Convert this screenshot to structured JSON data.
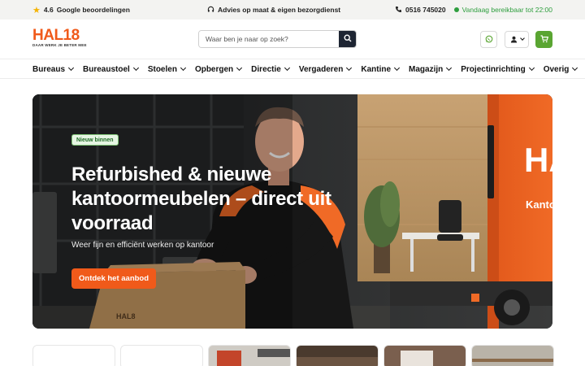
{
  "topbar": {
    "rating": "4.6",
    "rating_label": "Google beoordelingen",
    "advice": "Advies op maat & eigen bezorgdienst",
    "phone": "0516 745020",
    "availability": "Vandaag bereikbaar tot 22:00"
  },
  "header": {
    "logo_text": "HAL18",
    "logo_tagline": "DAAR WERK JE BETER MEE",
    "search_placeholder": "Waar ben je naar op zoek?"
  },
  "nav": {
    "items": [
      {
        "label": "Bureaus"
      },
      {
        "label": "Bureaustoel"
      },
      {
        "label": "Stoelen"
      },
      {
        "label": "Opbergen"
      },
      {
        "label": "Directie"
      },
      {
        "label": "Vergaderen"
      },
      {
        "label": "Kantine"
      },
      {
        "label": "Magazijn"
      },
      {
        "label": "Projectinrichting"
      },
      {
        "label": "Overig"
      }
    ]
  },
  "hero": {
    "badge": "Nieuw binnen",
    "title": "Refurbished & nieuwe kantoormeubelen – direct uit voorraad",
    "subtitle": "Weer fijn en efficiënt werken op kantoor",
    "cta": "Ontdek het aanbod",
    "truck_text_1": "HA",
    "truck_text_2": "Kantoor",
    "box_text": "HAL8"
  },
  "colors": {
    "brand_orange": "#f05a1a",
    "cart_green": "#5aa532",
    "search_dark": "#1e2533",
    "status_green": "#2e9e3e"
  },
  "icons": [
    "star-icon",
    "headset-icon",
    "phone-icon",
    "search-icon",
    "whatsapp-icon",
    "user-icon",
    "cart-icon",
    "chevron-down-icon"
  ]
}
